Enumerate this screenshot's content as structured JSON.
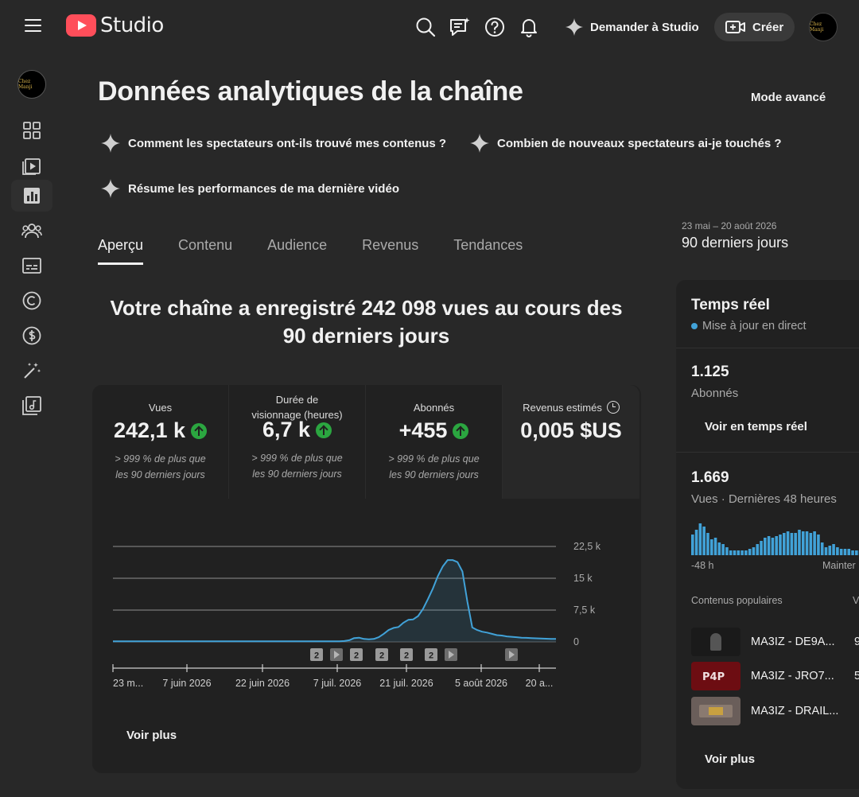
{
  "header": {
    "logo_text": "Studio",
    "ask_label": "Demander à Studio",
    "create_label": "Créer",
    "avatar_text": "Chez Manji",
    "accent": "#ff4e5a"
  },
  "sidebar": {
    "items": [
      {
        "name": "dashboard",
        "icon": "dashboard-icon"
      },
      {
        "name": "content",
        "icon": "content-icon"
      },
      {
        "name": "analytics",
        "icon": "analytics-icon",
        "active": true
      },
      {
        "name": "community",
        "icon": "community-icon"
      },
      {
        "name": "subtitles",
        "icon": "subtitles-icon"
      },
      {
        "name": "copyright",
        "icon": "copyright-icon"
      },
      {
        "name": "earn",
        "icon": "dollar-icon"
      },
      {
        "name": "customization",
        "icon": "magic-wand-icon"
      },
      {
        "name": "audio-library",
        "icon": "audio-library-icon"
      }
    ]
  },
  "page": {
    "title": "Données analytiques de la chaîne",
    "mode_label": "Mode avancé",
    "suggestions": [
      "Comment les spectateurs ont-ils trouvé mes contenus ?",
      "Combien de nouveaux spectateurs ai-je touchés ?",
      "Résume les performances de ma dernière vidéo"
    ],
    "tabs": [
      "Aperçu",
      "Contenu",
      "Audience",
      "Revenus",
      "Tendances"
    ],
    "active_tab": 0,
    "date_range": "23 mai – 20 août 2026",
    "period": "90 derniers jours",
    "headline": "Votre chaîne a enregistré 242 098 vues au cours des 90 derniers jours"
  },
  "metrics": [
    {
      "label": "Vues",
      "value": "242,1 k",
      "trend": "up",
      "compare": "> 999 % de plus que les 90 derniers jours"
    },
    {
      "label": "Durée de visionnage (heures)",
      "value": "6,7 k",
      "trend": "up",
      "compare": "> 999 % de plus que les 90 derniers jours"
    },
    {
      "label": "Abonnés",
      "value": "+455",
      "trend": "up",
      "compare": "> 999 % de plus que les 90 derniers jours"
    },
    {
      "label": "Revenus estimés",
      "value": "0,005 $US",
      "trend": "none",
      "compare": ""
    }
  ],
  "chart_data": {
    "type": "area",
    "x_tick_labels": [
      "23 m...",
      "7 juin 2026",
      "22 juin 2026",
      "7 juil. 2026",
      "21 juil. 2026",
      "5 août 2026",
      "20 a..."
    ],
    "y_tick_labels": [
      "22,5 k",
      "15 k",
      "7,5 k",
      "0"
    ],
    "ylim": [
      0,
      22500
    ],
    "grid": true,
    "color": "#41a2d8",
    "series": [
      {
        "values": [
          150,
          150,
          150,
          150,
          150,
          150,
          150,
          150,
          150,
          150,
          150,
          150,
          150,
          150,
          150,
          150,
          150,
          150,
          150,
          150,
          150,
          150,
          150,
          150,
          150,
          150,
          150,
          150,
          150,
          150,
          150,
          150,
          150,
          150,
          150,
          150,
          150,
          150,
          150,
          150,
          150,
          150,
          150,
          150,
          150,
          150,
          150,
          200,
          400,
          900,
          1000,
          700,
          600,
          700,
          1100,
          1900,
          2800,
          3300,
          3500,
          4500,
          5200,
          5300,
          6100,
          7800,
          10100,
          12600,
          15500,
          17800,
          19300,
          19300,
          18800,
          16600,
          9500,
          3400,
          2800,
          2400,
          2200,
          1900,
          1600,
          1500,
          1300,
          1200,
          1100,
          1000,
          950,
          900,
          850,
          800,
          750,
          700,
          700
        ]
      }
    ],
    "event_markers": [
      "2",
      "",
      "2",
      "2",
      "2",
      "2",
      "",
      ""
    ]
  },
  "chart_more_label": "Voir plus",
  "realtime": {
    "title": "Temps réel",
    "live_label": "Mise à jour en direct",
    "subs_value": "1.125",
    "subs_label": "Abonnés",
    "see_realtime_label": "Voir en temps réel",
    "views_value": "1.669",
    "views_label": "Vues · Dernières 48 heures",
    "axis_left": "-48 h",
    "axis_right": "Mainter",
    "bars": [
      26,
      32,
      40,
      36,
      28,
      20,
      22,
      16,
      14,
      10,
      6,
      6,
      6,
      6,
      6,
      8,
      10,
      14,
      18,
      22,
      24,
      22,
      24,
      26,
      28,
      30,
      28,
      28,
      32,
      30,
      30,
      28,
      30,
      26,
      16,
      10,
      12,
      14,
      10,
      8,
      8,
      8,
      6,
      6,
      6,
      8,
      10,
      12
    ],
    "top_content_label": "Contenus populaires",
    "views_col_label": "V",
    "videos": [
      {
        "title": "MA3IZ - DE9A...",
        "views": "9"
      },
      {
        "title": "MA3IZ - JRO7...",
        "views": "5"
      },
      {
        "title": "MA3IZ - DRAIL...",
        "views": ""
      }
    ],
    "more_label": "Voir plus"
  }
}
